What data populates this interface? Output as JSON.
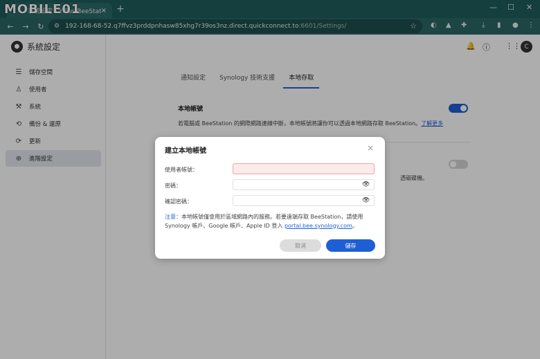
{
  "browser": {
    "tab_title": "系統設定 - YiFan-BeeStation",
    "tab_close": "×",
    "new_tab": "+",
    "url_main": "192-168-68-52.q7ffvz3prddpnhasw85xhg7r39os3nz.direct.quickconnect.to",
    "url_port": ":6601/Settings/",
    "watermark": "MOBILE01",
    "avatar_initial": "C"
  },
  "app": {
    "title": "系統設定",
    "user_initial": "C"
  },
  "sidebar": {
    "items": [
      {
        "label": "儲存空間",
        "icon": "storage-icon",
        "active": false
      },
      {
        "label": "使用者",
        "icon": "user-icon",
        "active": false
      },
      {
        "label": "系統",
        "icon": "wrench-icon",
        "active": false
      },
      {
        "label": "備份 & 還原",
        "icon": "backup-icon",
        "active": false
      },
      {
        "label": "更新",
        "icon": "refresh-icon",
        "active": false
      },
      {
        "label": "進階設定",
        "icon": "advanced-icon",
        "active": true
      }
    ]
  },
  "tabs": {
    "items": [
      {
        "label": "通知設定",
        "active": false
      },
      {
        "label": "Synology 技術支援",
        "active": false
      },
      {
        "label": "本地存取",
        "active": true
      }
    ]
  },
  "section": {
    "title": "本地帳號",
    "desc": "若電腦或 BeeStation 的網際網路連線中斷，本地帳號將讓你可以透過本地網路存取 BeeStation。",
    "link": "了解更多",
    "toggle_on": true,
    "partial_text": "透磁碟機。"
  },
  "dialog": {
    "title": "建立本地帳號",
    "close": "×",
    "username_label": "使用者帳號：",
    "username_value": "",
    "password_label": "密碼：",
    "confirm_label": "確認密碼：",
    "note_prefix": "注意：",
    "note_text": "本地帳號僅會用於區域網路內的服務。若要遠端存取 BeeStation，請使用 Synology 帳戶、Google 帳戶、Apple ID 登入 ",
    "note_link": "portal.bee.synology.com",
    "note_end": "。",
    "cancel_label": "取消",
    "save_label": "儲存"
  },
  "colors": {
    "accent": "#1f5fd6",
    "browser_frame": "#1f5e5c",
    "error_field": "#fdeaea"
  }
}
